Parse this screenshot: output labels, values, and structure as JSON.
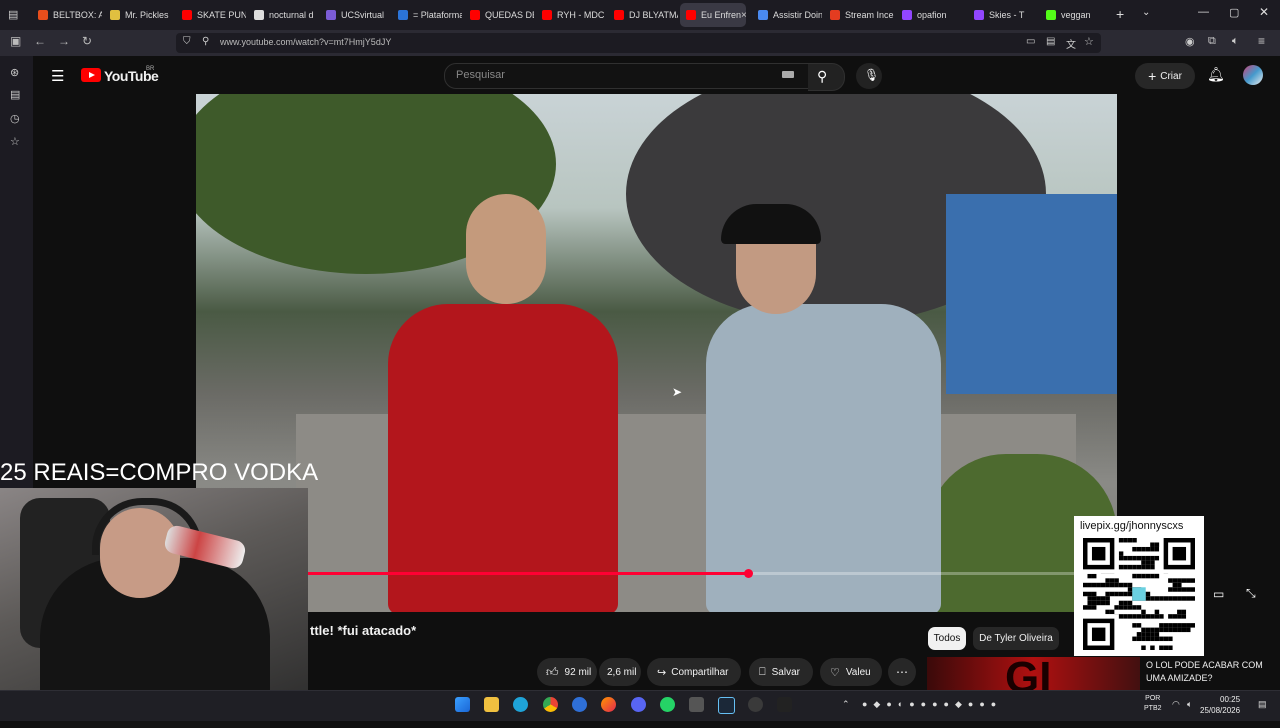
{
  "browser": {
    "tabs": [
      {
        "label": "BELTBOX: Ar",
        "color": "#e84e1c"
      },
      {
        "label": "Mr. Pickles",
        "color": "#e0c040"
      },
      {
        "label": "SKATE PUN",
        "color": "#ff0000"
      },
      {
        "label": "nocturnal d",
        "color": "#dddddd"
      },
      {
        "label": "UCSvirtual",
        "color": "#7b5cd6"
      },
      {
        "label": "= Plataforma",
        "color": "#2b74d8"
      },
      {
        "label": "QUEDAS DE",
        "color": "#ff0000"
      },
      {
        "label": "RYH - MDC",
        "color": "#ff0000"
      },
      {
        "label": "DJ BLYATMA",
        "color": "#ff0000"
      },
      {
        "label": "Eu Enfren",
        "color": "#ff0000",
        "active": true
      },
      {
        "label": "Assistir Doin",
        "color": "#4a8af0"
      },
      {
        "label": "Stream Ince",
        "color": "#e43c20"
      },
      {
        "label": "opafion",
        "color": "#9146ff"
      },
      {
        "label": "Skies - T",
        "color": "#9146ff"
      },
      {
        "label": "veggan",
        "color": "#53fc18"
      }
    ],
    "url": "www.youtube.com/watch?v=mt7HmjY5dJY"
  },
  "youtube": {
    "logo_text": "YouTube",
    "region": "BR",
    "search_placeholder": "Pesquisar",
    "create_label": "Criar",
    "video_title": "ttle! *fui atacado*",
    "likes": "92 mil",
    "comments": "2,6 mil",
    "share_label": "Compartilhar",
    "save_label": "Salvar",
    "thanks_label": "Valeu",
    "chips": {
      "all": "Todos",
      "tyler": "De Tyler Oliveira"
    },
    "related_title": "O LOL PODE ACABAR COM UMA AMIZADE?",
    "related_thumb_text": "GI",
    "progress": 0.575
  },
  "stream_overlay": {
    "text": "25 REAIS=COMPRO VODKA",
    "qr_label": "livepix.gg/jhonnyscxs"
  },
  "taskbar": {
    "lang_top": "POR",
    "lang_bottom": "PTB2",
    "time": "00:25",
    "date": "25/08/2026"
  }
}
